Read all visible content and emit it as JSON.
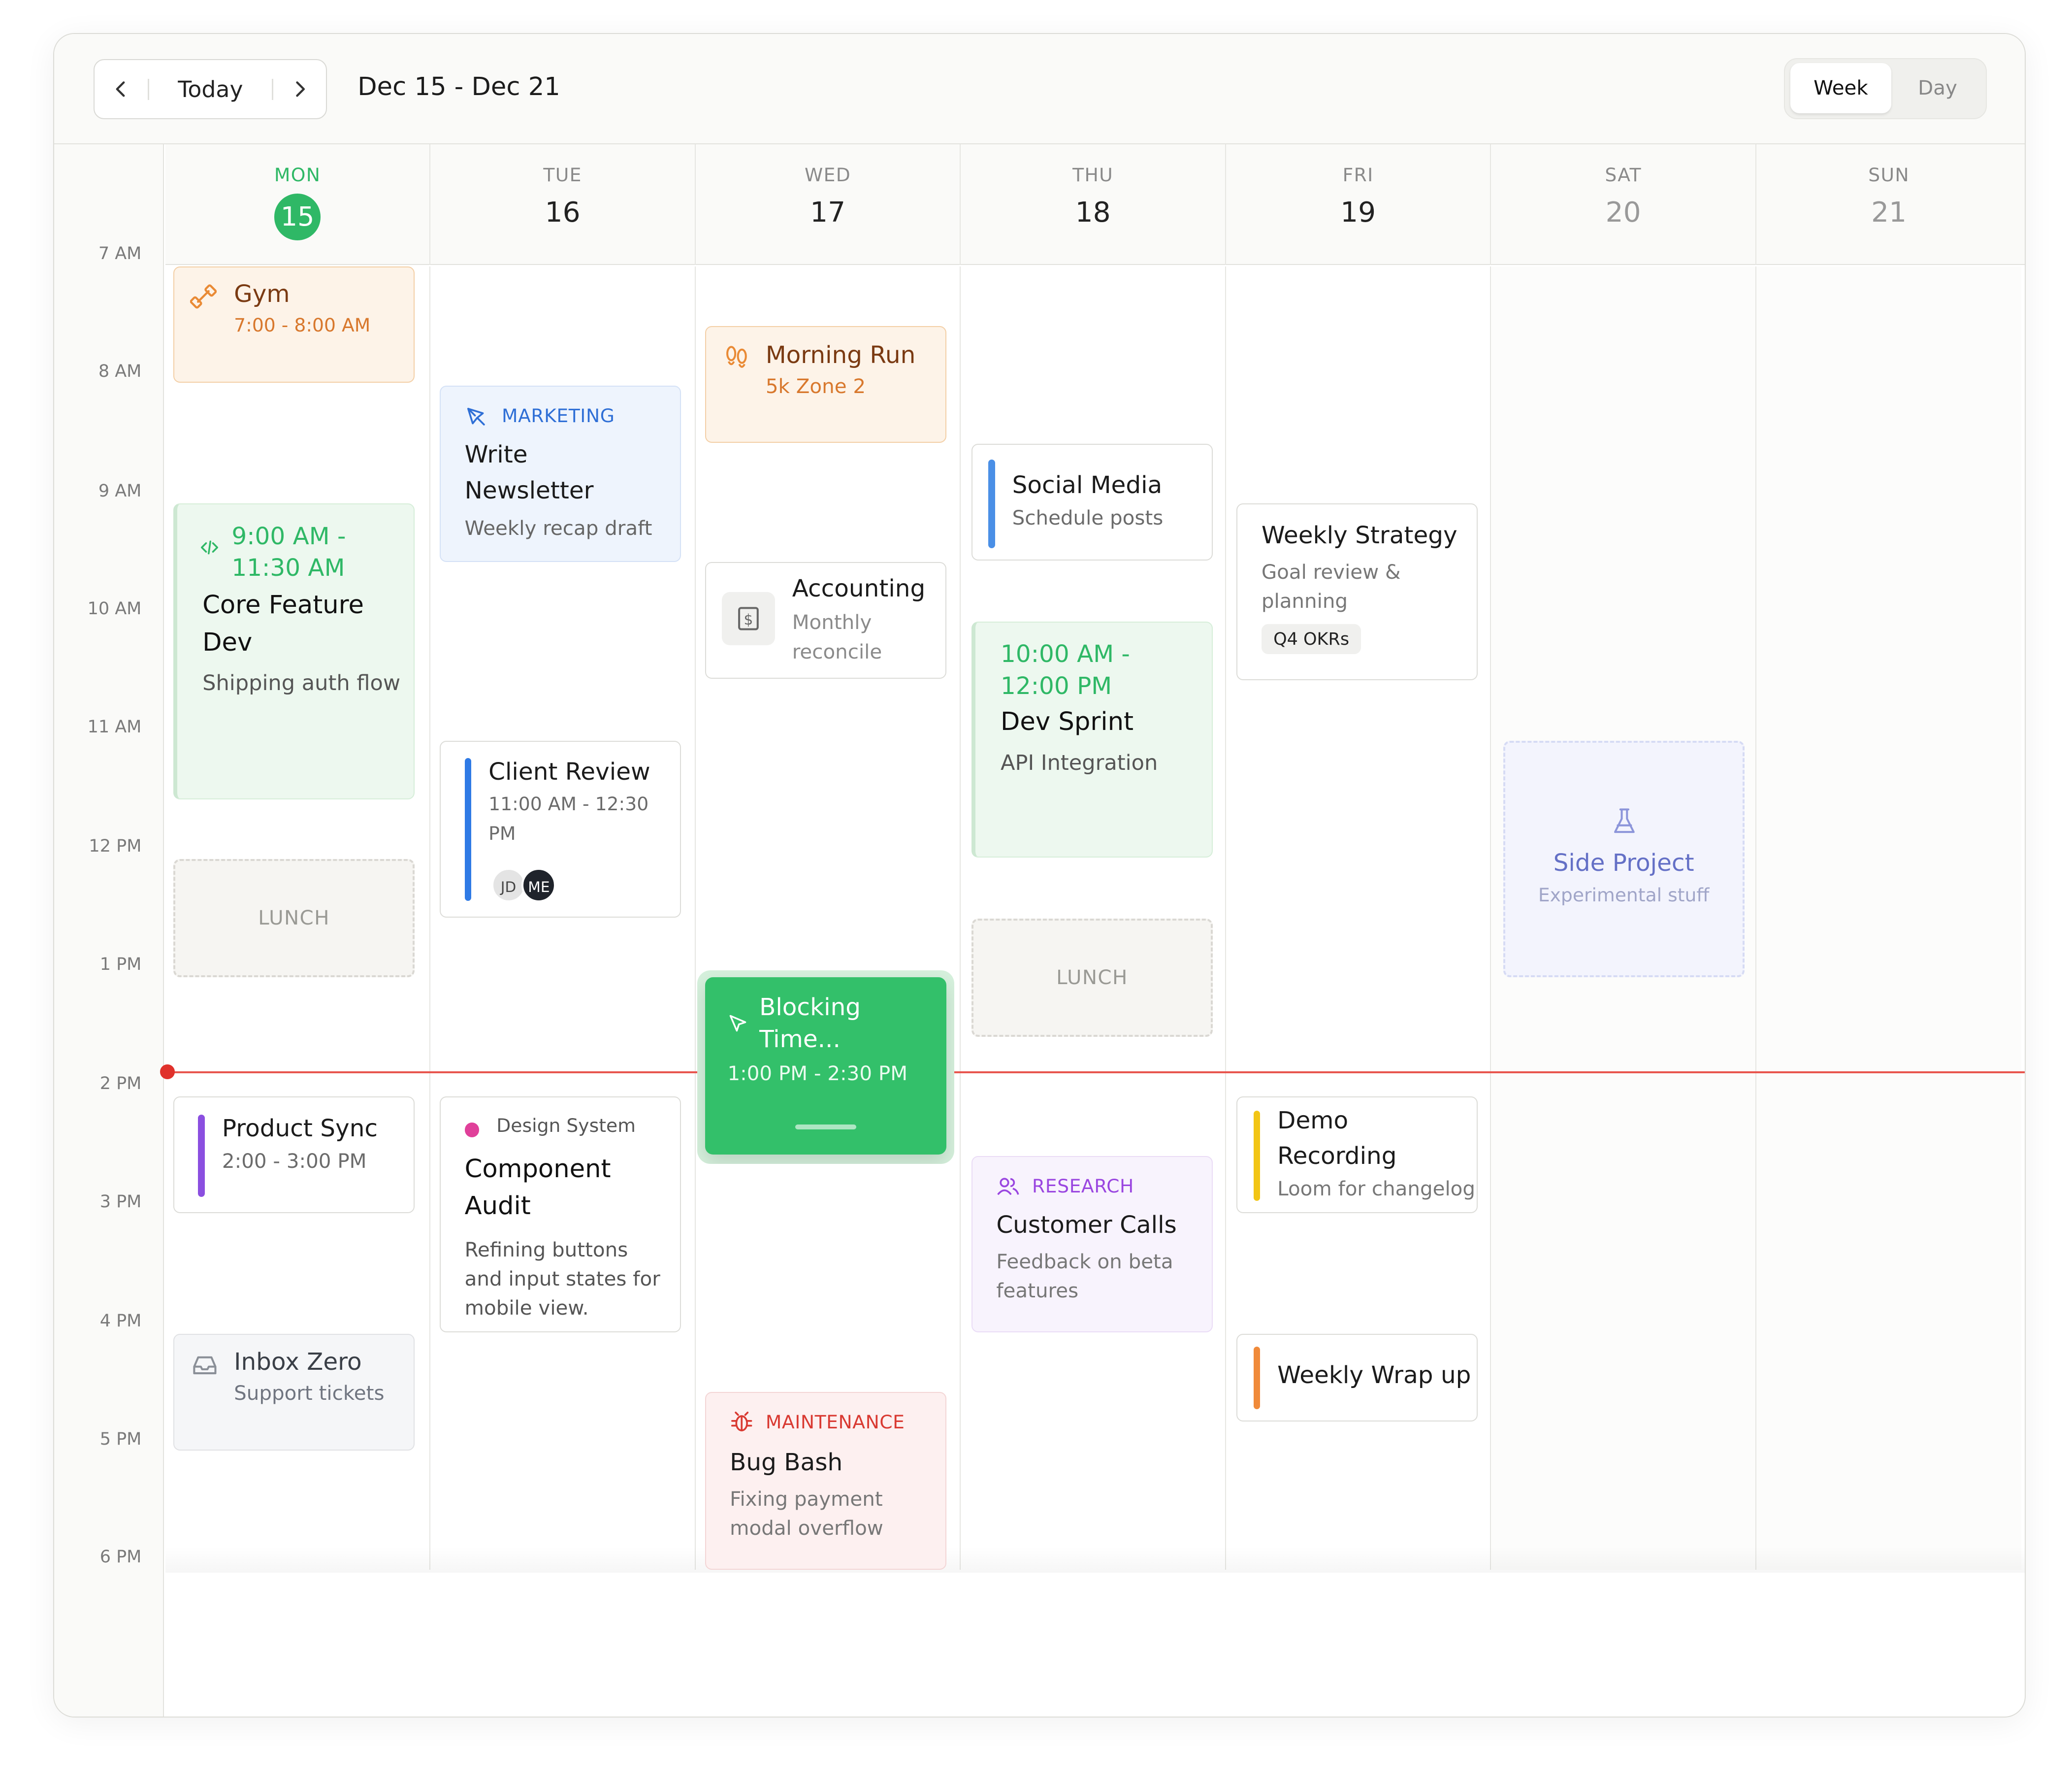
{
  "header": {
    "today_label": "Today",
    "date_range": "Dec 15 - Dec 21",
    "view_week": "Week",
    "view_day": "Day",
    "prev_icon": "chevron-left-icon",
    "next_icon": "chevron-right-icon"
  },
  "days": [
    {
      "name": "MON",
      "num": "15"
    },
    {
      "name": "TUE",
      "num": "16"
    },
    {
      "name": "WED",
      "num": "17"
    },
    {
      "name": "THU",
      "num": "18"
    },
    {
      "name": "FRI",
      "num": "19"
    },
    {
      "name": "SAT",
      "num": "20"
    },
    {
      "name": "SUN",
      "num": "21"
    }
  ],
  "hours": [
    "7 AM",
    "8 AM",
    "9 AM",
    "10 AM",
    "11 AM",
    "12 PM",
    "1 PM",
    "2 PM",
    "3 PM",
    "4 PM",
    "5 PM",
    "6 PM"
  ],
  "events": {
    "gym": {
      "title": "Gym",
      "time": "7:00 - 8:00 AM",
      "icon": "dumbbell-icon"
    },
    "core": {
      "time": "9:00 AM - 11:30 AM",
      "title": "Core Feature Dev",
      "subtitle": "Shipping auth flow",
      "icon": "code-icon"
    },
    "lunch_mon": {
      "label": "LUNCH"
    },
    "product_sync": {
      "title": "Product Sync",
      "time": "2:00 - 3:00 PM"
    },
    "inbox": {
      "title": "Inbox Zero",
      "subtitle": "Support tickets",
      "icon": "inbox-icon"
    },
    "newsletter": {
      "tag": "MARKETING",
      "title": "Write Newsletter",
      "subtitle": "Weekly recap draft",
      "icon": "pen-tool-icon"
    },
    "client_review": {
      "title": "Client Review",
      "time": "11:00 AM - 12:30 PM",
      "avatars": [
        "JD",
        "ME"
      ]
    },
    "component_audit": {
      "tag": "Design System",
      "title": "Component Audit",
      "subtitle": "Refining buttons and input states for mobile view."
    },
    "morning_run": {
      "title": "Morning Run",
      "subtitle": "5k Zone 2",
      "icon": "footprints-icon"
    },
    "accounting": {
      "title": "Accounting",
      "subtitle": "Monthly reconcile",
      "icon": "receipt-icon"
    },
    "blocking": {
      "title": "Blocking Time...",
      "time": "1:00 PM - 2:30 PM",
      "icon": "cursor-icon"
    },
    "bug_bash": {
      "tag": "MAINTENANCE",
      "title": "Bug Bash",
      "subtitle": "Fixing payment modal overflow",
      "icon": "bug-icon"
    },
    "social": {
      "title": "Social Media",
      "subtitle": "Schedule posts"
    },
    "dev_sprint": {
      "time": "10:00 AM - 12:00 PM",
      "title": "Dev Sprint",
      "subtitle": "API Integration"
    },
    "lunch_thu": {
      "label": "LUNCH"
    },
    "customer_calls": {
      "tag": "RESEARCH",
      "title": "Customer Calls",
      "subtitle": "Feedback on beta features",
      "icon": "users-icon"
    },
    "weekly_strategy": {
      "title": "Weekly Strategy",
      "subtitle": "Goal review & planning",
      "badge": "Q4 OKRs"
    },
    "demo": {
      "title": "Demo Recording",
      "subtitle": "Loom for changelog"
    },
    "wrap": {
      "title": "Weekly Wrap up"
    },
    "side_project": {
      "title": "Side Project",
      "subtitle": "Experimental stuff",
      "icon": "flask-icon"
    }
  },
  "colors": {
    "accent_green": "#2fb866",
    "now_line": "#e8554e"
  }
}
